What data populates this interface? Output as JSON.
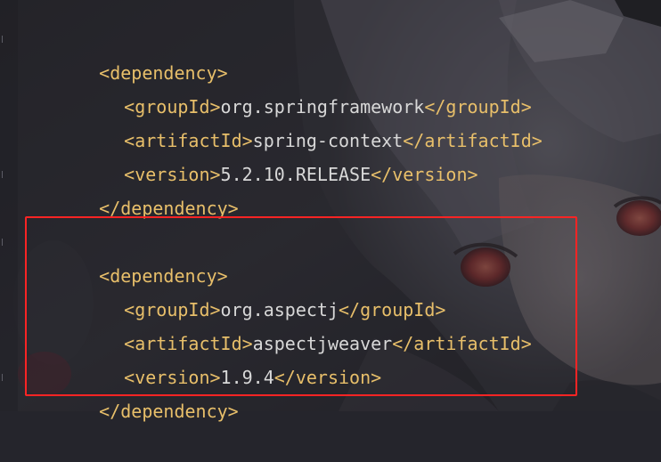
{
  "editor": {
    "lines": [
      {
        "open": "<dependency>",
        "value": "",
        "close": ""
      },
      {
        "open": "<groupId>",
        "value": "org.springframework",
        "close": "</groupId>"
      },
      {
        "open": "<artifactId>",
        "value": "spring-context",
        "close": "</artifactId>"
      },
      {
        "open": "<version>",
        "value": "5.2.10.RELEASE",
        "close": "</version>"
      },
      {
        "open": "</dependency>",
        "value": "",
        "close": ""
      },
      {
        "open": "<dependency>",
        "value": "",
        "close": ""
      },
      {
        "open": "<groupId>",
        "value": "org.aspectj",
        "close": "</groupId>"
      },
      {
        "open": "<artifactId>",
        "value": "aspectjweaver",
        "close": "</artifactId>"
      },
      {
        "open": "<version>",
        "value": "1.9.4",
        "close": "</version>"
      },
      {
        "open": "</dependency>",
        "value": "",
        "close": ""
      }
    ]
  },
  "colors": {
    "tag": "#e8bf6a",
    "text": "#d8d8d8",
    "highlight_border": "#ff2424",
    "background": "#25252c"
  }
}
